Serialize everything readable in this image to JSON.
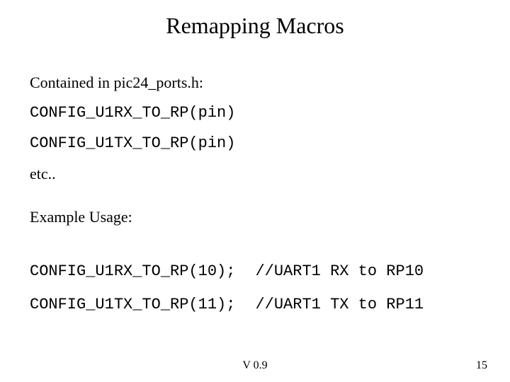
{
  "title": "Remapping Macros",
  "intro": "Contained in pic24_ports.h:",
  "macros": [
    "CONFIG_U1RX_TO_RP(pin)",
    "CONFIG_U1TX_TO_RP(pin)"
  ],
  "etc": "etc..",
  "example_heading": "Example Usage:",
  "examples": [
    {
      "code": "CONFIG_U1RX_TO_RP(10);",
      "comment": "//UART1 RX to RP10"
    },
    {
      "code": "CONFIG_U1TX_TO_RP(11);",
      "comment": "//UART1 TX to RP11"
    }
  ],
  "footer": {
    "version": "V 0.9",
    "page": "15"
  }
}
